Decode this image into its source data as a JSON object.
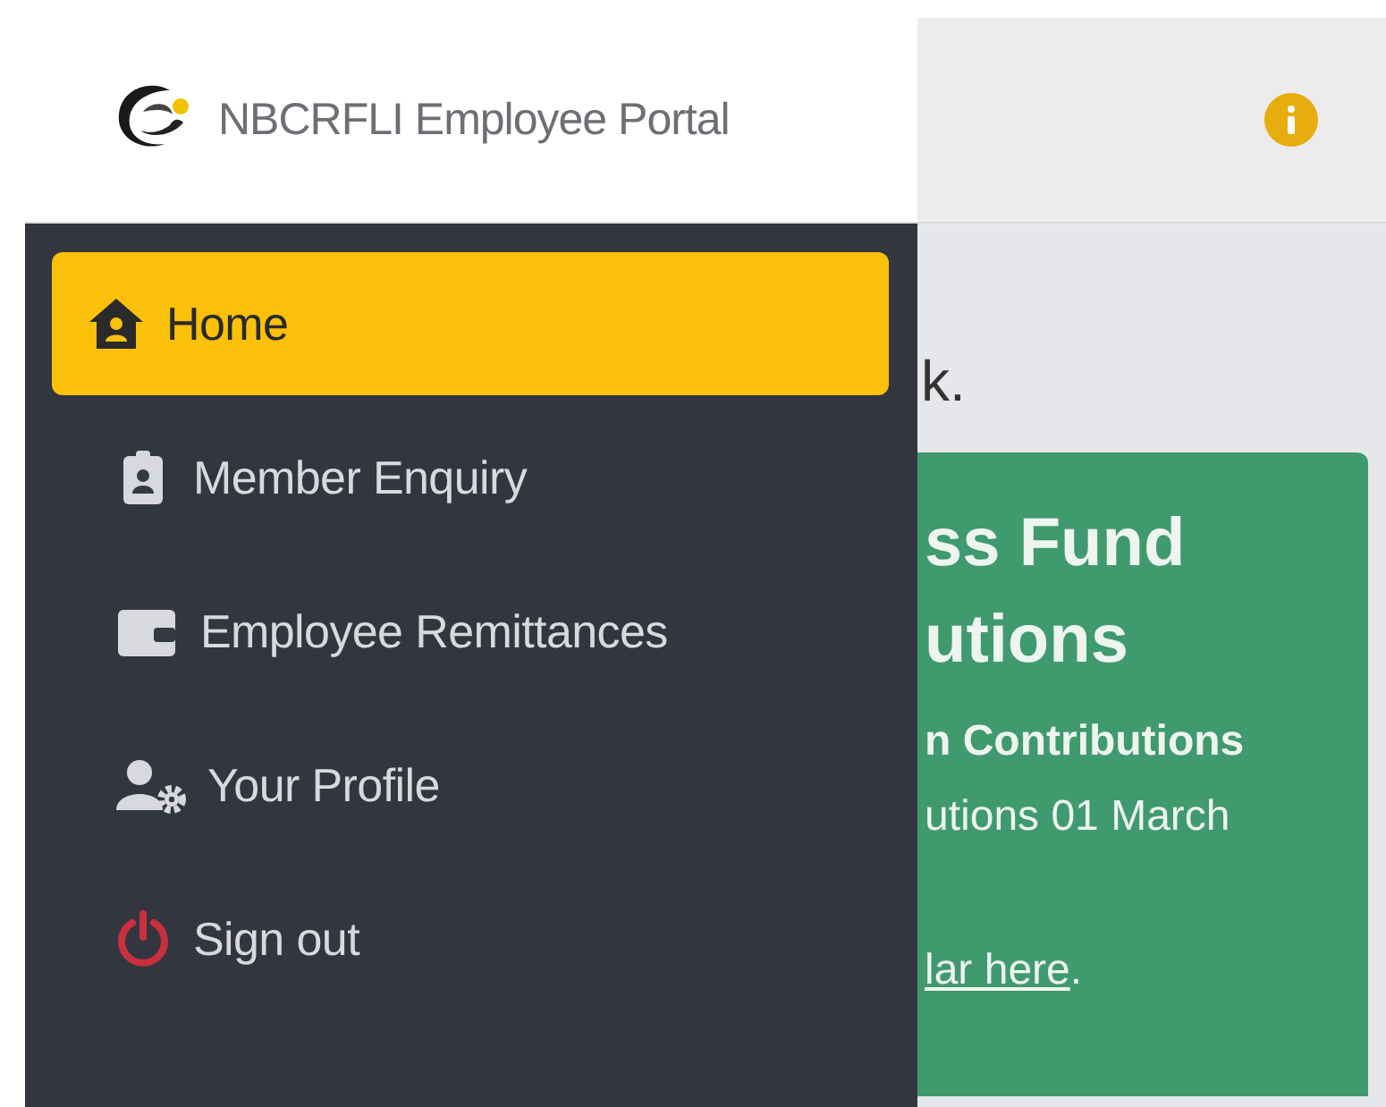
{
  "sidebar": {
    "title": "NBCRFLI Employee Portal",
    "items": [
      {
        "label": "Home",
        "kind": "home",
        "selected": true
      },
      {
        "label": "Member Enquiry",
        "kind": "badge",
        "selected": false
      },
      {
        "label": "Employee Remittances",
        "kind": "wallet",
        "selected": false
      },
      {
        "label": "Your Profile",
        "kind": "profile",
        "selected": false
      },
      {
        "label": "Sign out",
        "kind": "power",
        "selected": false
      }
    ]
  },
  "main": {
    "greeting": "k.",
    "card": {
      "title_lines": [
        "ss Fund",
        "utions"
      ],
      "subtitle": "n Contributions",
      "body": "utions 01 March",
      "link": "lar here",
      "link_suffix": "."
    }
  }
}
